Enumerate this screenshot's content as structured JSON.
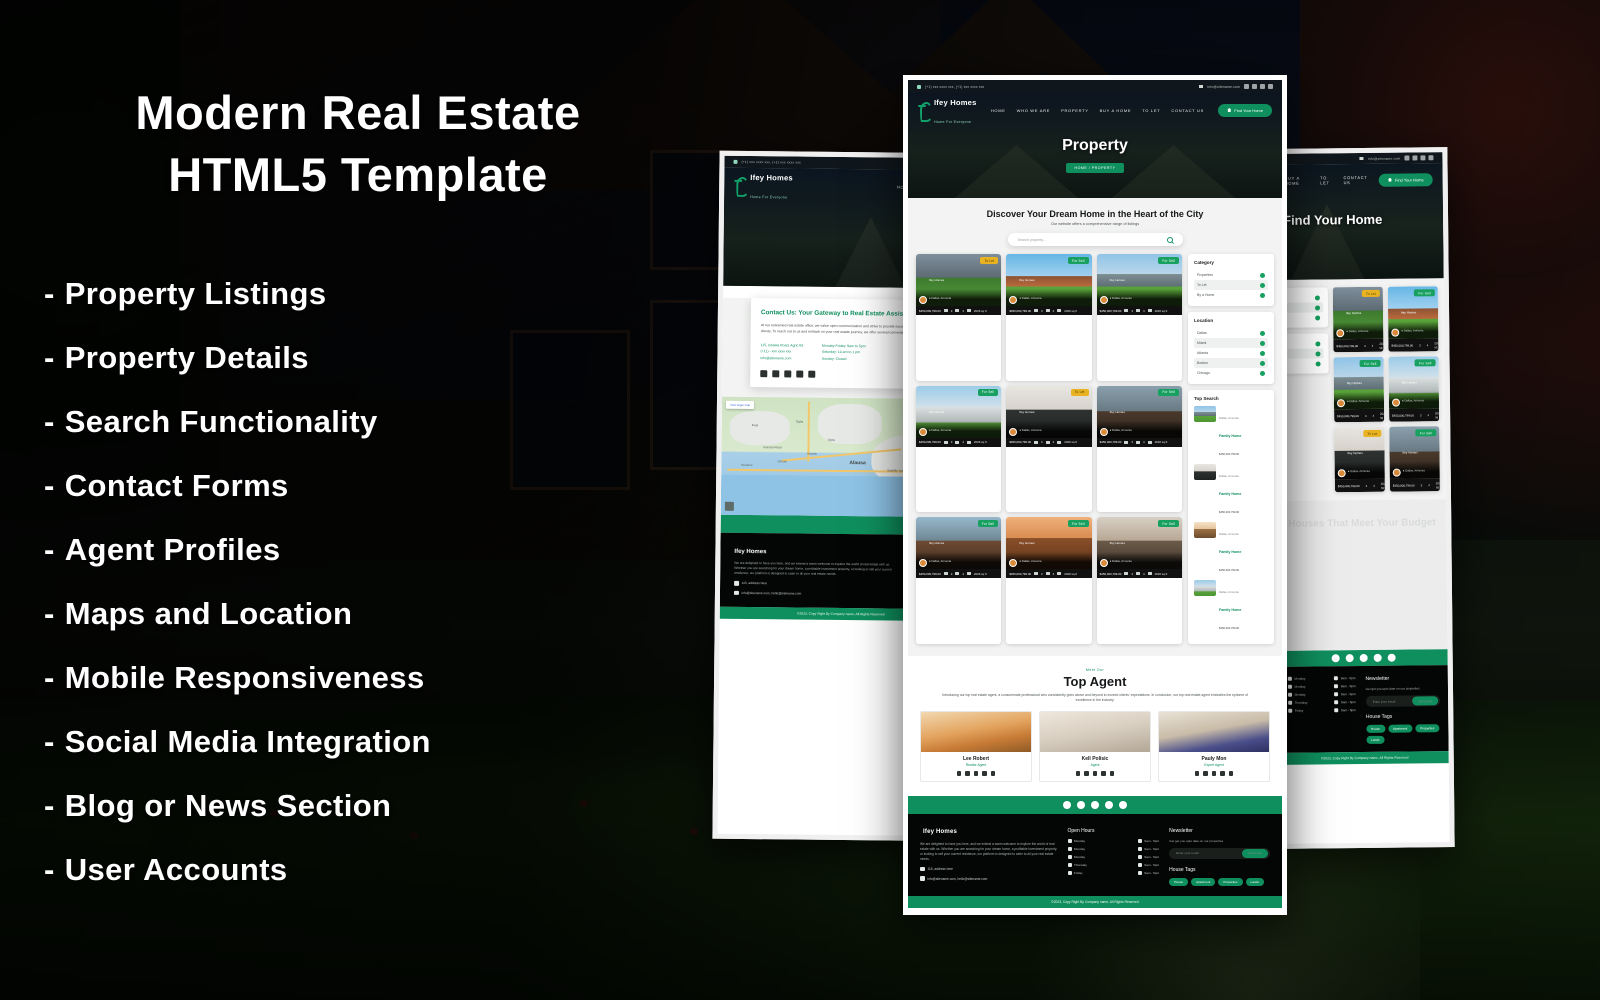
{
  "hero": {
    "headline_line1": "Modern Real Estate",
    "headline_line2": "HTML5 Template",
    "features": [
      "Property Listings",
      "Property Details",
      "Search Functionality",
      "Contact Forms",
      "Agent Profiles",
      "Maps and Location",
      "Mobile Responsiveness",
      "Social Media Integration",
      "Blog or News Section",
      "User Accounts"
    ],
    "bullet_dash": "-"
  },
  "colors": {
    "brand_green": "#0f8f5e",
    "badge_sell": "#17a05f",
    "badge_let": "#e8b221",
    "dark": "#040605"
  },
  "site": {
    "topbar": {
      "phone": "(+1) xxx xxxx xxx, (+1) xxx xxxx xxx",
      "email": "info@sitename.com",
      "socials": [
        "facebook-icon",
        "instagram-icon",
        "twitter-icon",
        "linkedin-icon"
      ]
    },
    "brand": {
      "name": "Ifey Homes",
      "tagline": "Home For Everyone"
    },
    "menu": [
      "HOME",
      "WHO WE ARE",
      "PROPERTY",
      "BUY A HOME",
      "TO LET",
      "CONTACT US"
    ],
    "cta": "Find Your Home"
  },
  "property_page": {
    "hero_title": "Property",
    "breadcrumb": "HOME / PROPERTY",
    "search_heading": "Discover Your Dream Home in the Heart of the City",
    "search_sub": "Our website offers a comprehensive range of listings",
    "search_placeholder": "Search property...",
    "cards": [
      {
        "badge": "To Let",
        "badge_type": "let",
        "agent": "Ifey Homes",
        "location": "Dallas, Armenia",
        "price": "$450,000,799.00",
        "beds": "3",
        "baths": "4",
        "area": "2026 sq ft",
        "photo": "ph1"
      },
      {
        "badge": "For Sell",
        "badge_type": "sell",
        "agent": "Ifey Homes",
        "location": "Dallas, Armenia",
        "price": "$450,000,799.00",
        "beds": "3",
        "baths": "4",
        "area": "2026 sq ft",
        "photo": "ph2"
      },
      {
        "badge": "For Sell",
        "badge_type": "sell",
        "agent": "Ifey Homes",
        "location": "Dallas, Armenia",
        "price": "$450,000,799.00",
        "beds": "3",
        "baths": "4",
        "area": "2026 sq ft",
        "photo": "ph3"
      },
      {
        "badge": "For Sell",
        "badge_type": "sell",
        "agent": "Ifey Homes",
        "location": "Dallas, Armenia",
        "price": "$450,000,799.00",
        "beds": "3",
        "baths": "4",
        "area": "2026 sq ft",
        "photo": "ph4"
      },
      {
        "badge": "To Let",
        "badge_type": "let",
        "agent": "Ifey Homes",
        "location": "Dallas, Armenia",
        "price": "$450,000,799.00",
        "beds": "3",
        "baths": "4",
        "area": "2026 sq ft",
        "photo": "ph5"
      },
      {
        "badge": "For Sell",
        "badge_type": "sell",
        "agent": "Ifey Homes",
        "location": "Dallas, Armenia",
        "price": "$450,000,799.00",
        "beds": "3",
        "baths": "4",
        "area": "2026 sq ft",
        "photo": "ph6"
      },
      {
        "badge": "For Sell",
        "badge_type": "sell",
        "agent": "Ifey Homes",
        "location": "Dallas, Armenia",
        "price": "$450,000,799.00",
        "beds": "3",
        "baths": "4",
        "area": "2026 sq ft",
        "photo": "ph7"
      },
      {
        "badge": "For Sell",
        "badge_type": "sell",
        "agent": "Ifey Homes",
        "location": "Dallas, Armenia",
        "price": "$450,000,799.00",
        "beds": "3",
        "baths": "4",
        "area": "2026 sq ft",
        "photo": "ph8"
      },
      {
        "badge": "For Sell",
        "badge_type": "sell",
        "agent": "Ifey Homes",
        "location": "Dallas, Armenia",
        "price": "$450,000,799.00",
        "beds": "3",
        "baths": "4",
        "area": "2026 sq ft",
        "photo": "ph9"
      }
    ],
    "sidebar": {
      "category_title": "Category",
      "categories": [
        "Properties",
        "To Let",
        "By a Home"
      ],
      "location_title": "Location",
      "locations": [
        "Dallas",
        "Miami",
        "Atlanta",
        "Boston",
        "Chicago"
      ],
      "top_search_title": "Top Search",
      "top_search": [
        {
          "location": "Dallas, Armenia",
          "name": "Family Home",
          "price": "$450,000,799.00",
          "photo": "ph3"
        },
        {
          "location": "Dallas, Armenia",
          "name": "Family Home",
          "price": "$450,000,799.00",
          "photo": "ph5"
        },
        {
          "location": "Dallas, Armenia",
          "name": "Family Home",
          "price": "$450,000,799.00",
          "photo": "pha"
        },
        {
          "location": "Dallas, Armenia",
          "name": "Family Home",
          "price": "$450,000,799.00",
          "photo": "ph4"
        }
      ]
    },
    "agents_section": {
      "eyebrow": "Meet Our",
      "title": "Top Agent",
      "description": "Introducing our top real estate agent, a consummate professional who consistently goes above and beyond to exceed clients' expectations. In conclusion, our top real estate agent embodies the epitome of excellence in the industry.",
      "agents": [
        {
          "name": "Lee Robert",
          "role": "Realtor Agent",
          "photo": "agp1"
        },
        {
          "name": "Kell Polisic",
          "role": "Agent",
          "photo": "agp2"
        },
        {
          "name": "Pauly Mon",
          "role": "Expert Agent",
          "photo": "agp3"
        }
      ]
    }
  },
  "contact_page": {
    "title": "Contact Us: Your Gateway to Real Estate Assistance",
    "body": "At our esteemed real estate office, we value open communication and strive to provide exceptional service to our clients. To reach out to us and embark on your real estate journey, we offer several convenient contact options:",
    "address": "115, Ishawa Road, Agric ltd.",
    "phone": "(+11) - xxx xxxx xxx",
    "email": "info@sitename.com",
    "hours_mon_fri": "Monday-Friday: 9am to 5pm",
    "hours_sat": "Saturday: 10 am to 1 pm",
    "hours_sun": "Sunday: Closed",
    "map": {
      "view_larger": "View larger map",
      "labels": [
        "Agege",
        "Alausa",
        "Satellite Town",
        "Ikeja",
        "Ogba",
        "Mushin",
        "Ojota",
        "Ikorodu Road",
        "Oshodi",
        "Surulere",
        "Apapa",
        "Yaba"
      ]
    }
  },
  "footer": {
    "brand": "Ifey Homes",
    "description": "We are delighted to have you here, and we extend a warm welcome to explore the world of real estate with us. Whether you are searching for your dream home, a profitable investment property, or looking to sell your current residence, our platform is designed to cater to all your real estate needs.",
    "address": "115, address here",
    "emails": "info@sitename.com, hello@sitename.com",
    "open_hours_title": "Open Hours",
    "open_hours": [
      {
        "day": "Monday",
        "time": "9am - 5pm"
      },
      {
        "day": "Monday",
        "time": "9am - 5pm"
      },
      {
        "day": "Monday",
        "time": "9am - 5pm"
      },
      {
        "day": "Thursday",
        "time": "9am - 5pm"
      },
      {
        "day": "Friday",
        "time": "9am - 5pm"
      }
    ],
    "newsletter_title": "Newsletter",
    "newsletter_desc": "Get get you upto date on our properties",
    "newsletter_placeholder": "Enter your email",
    "newsletter_button": "Subscribe",
    "house_tags_title": "House Tags",
    "house_tags": [
      "House",
      "Apartment",
      "Properties",
      "Lands"
    ],
    "copyright": "©2023, Copy Right By Company name, All Rights Reserved"
  },
  "listing_page": {
    "hero_title": "Find Your Home",
    "section_heading": "Houses That Meet Your Budget"
  }
}
